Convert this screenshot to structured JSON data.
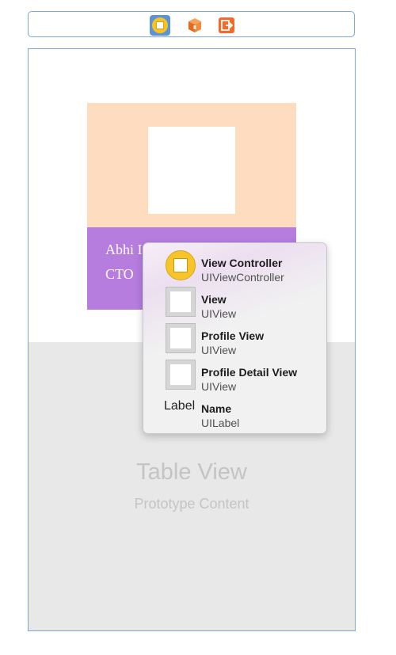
{
  "dock": {
    "icons": [
      "view-controller-icon",
      "first-responder-cube-icon",
      "exit-icon"
    ]
  },
  "scene": {
    "profile": {
      "name_text": "Abhi I",
      "role_text": "CTO"
    },
    "table_view": {
      "title": "Table View",
      "subtitle": "Prototype Content"
    }
  },
  "popup": {
    "items": [
      {
        "title": "View Controller",
        "subtitle": "UIViewController",
        "icon": "view-controller-icon"
      },
      {
        "title": "View",
        "subtitle": "UIView",
        "icon": "view-icon"
      },
      {
        "title": "Profile View",
        "subtitle": "UIView",
        "icon": "view-icon"
      },
      {
        "title": "Profile Detail View",
        "subtitle": "UIView",
        "icon": "view-icon"
      },
      {
        "title": "Name",
        "subtitle": "UILabel",
        "icon": "label-icon",
        "icon_text": "Label"
      }
    ]
  },
  "colors": {
    "accent_blue": "#5a93d9",
    "profile_bg": "#fedcbf",
    "detail_bg": "#b67ddf",
    "table_bg": "#e8e8e8",
    "vc_yellow": "#f7c52a"
  }
}
